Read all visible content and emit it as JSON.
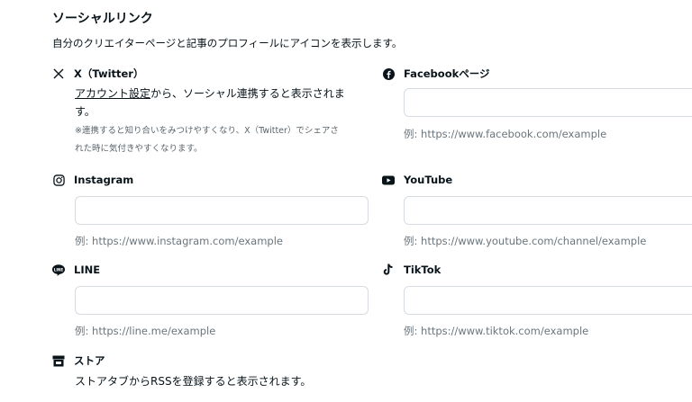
{
  "section": {
    "title": "ソーシャルリンク",
    "description": "自分のクリエイターページと記事のプロフィールにアイコンを表示します。"
  },
  "twitter": {
    "label": "X（Twitter）",
    "link_text": "アカウント設定",
    "note_rest": "から、ソーシャル連携すると表示されま",
    "note_wrap": "す。",
    "small_note_1": "※連携すると知り合いをみつけやすくなり、X（Twitter）でシェアさ",
    "small_note_2": "れた時に気付きやすくなります。"
  },
  "facebook": {
    "label": "Facebookページ",
    "value": "",
    "example": "例: https://www.facebook.com/example"
  },
  "instagram": {
    "label": "Instagram",
    "value": "",
    "example": "例: https://www.instagram.com/example"
  },
  "youtube": {
    "label": "YouTube",
    "value": "",
    "example": "例: https://www.youtube.com/channel/example"
  },
  "line": {
    "label": "LINE",
    "value": "",
    "example": "例: https://line.me/example"
  },
  "tiktok": {
    "label": "TikTok",
    "value": "",
    "example": "例: https://www.tiktok.com/example"
  },
  "store": {
    "label": "ストア",
    "note": "ストアタブからRSSを登録すると表示されます。"
  }
}
